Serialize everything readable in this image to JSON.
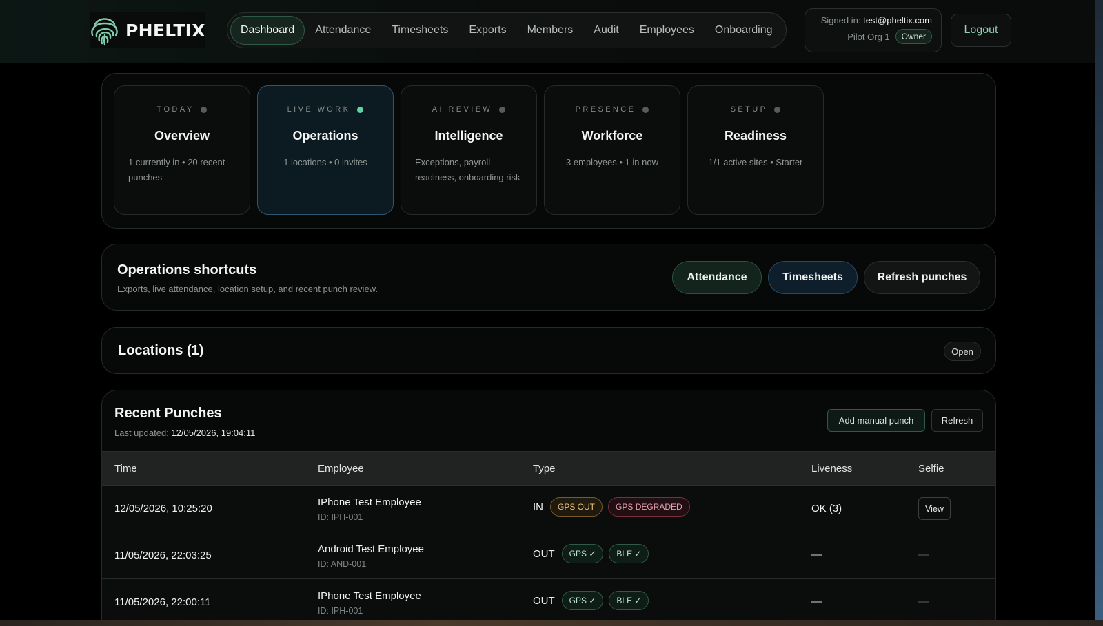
{
  "brand": {
    "name": "PHELTIX"
  },
  "nav": {
    "items": [
      {
        "label": "Dashboard",
        "active": true
      },
      {
        "label": "Attendance"
      },
      {
        "label": "Timesheets"
      },
      {
        "label": "Exports"
      },
      {
        "label": "Members"
      },
      {
        "label": "Audit"
      },
      {
        "label": "Employees"
      },
      {
        "label": "Onboarding"
      }
    ]
  },
  "account": {
    "signed_label": "Signed in:",
    "email": "test@pheltix.com",
    "org": "Pilot Org 1",
    "role": "Owner",
    "logout_label": "Logout"
  },
  "hub": {
    "cards": [
      {
        "eyebrow": "TODAY",
        "title": "Overview",
        "desc": "1 currently in • 20 recent punches"
      },
      {
        "eyebrow": "LIVE WORK",
        "title": "Operations",
        "desc": "1 locations • 0 invites",
        "active": true
      },
      {
        "eyebrow": "AI REVIEW",
        "title": "Intelligence",
        "desc": "Exceptions, payroll readiness, onboarding risk"
      },
      {
        "eyebrow": "PRESENCE",
        "title": "Workforce",
        "desc": "3 employees • 1 in now"
      },
      {
        "eyebrow": "SETUP",
        "title": "Readiness",
        "desc": "1/1 active sites • Starter"
      }
    ]
  },
  "shortcuts": {
    "title": "Operations shortcuts",
    "subtitle": "Exports, live attendance, location setup, and recent punch review.",
    "buttons": [
      "Attendance",
      "Timesheets",
      "Refresh punches"
    ]
  },
  "locations": {
    "title": "Locations (1)",
    "open_label": "Open"
  },
  "punches": {
    "title": "Recent Punches",
    "updated_label": "Last updated:",
    "updated_value": "12/05/2026, 19:04:11",
    "add_label": "Add manual punch",
    "refresh_label": "Refresh",
    "columns": [
      "Time",
      "Employee",
      "Type",
      "Liveness",
      "Selfie"
    ],
    "rows": [
      {
        "time": "12/05/2026, 10:25:20",
        "employee": "IPhone Test Employee",
        "id": "ID: IPH-001",
        "type": "IN",
        "tags": [
          "GPS OUT",
          "GPS DEGRADED"
        ],
        "liveness": "OK (3)",
        "selfie": "View"
      },
      {
        "time": "11/05/2026, 22:03:25",
        "employee": "Android Test Employee",
        "id": "ID: AND-001",
        "type": "OUT",
        "tags": [
          "GPS ✓",
          "BLE ✓"
        ],
        "liveness": "—",
        "selfie": "—"
      },
      {
        "time": "11/05/2026, 22:00:11",
        "employee": "IPhone Test Employee",
        "id": "ID: IPH-001",
        "type": "OUT",
        "tags": [
          "GPS ✓",
          "BLE ✓"
        ],
        "liveness": "—",
        "selfie": "—"
      }
    ]
  },
  "colors": {
    "accent": "#5fd3a0",
    "background": "#000000",
    "panel": "#070808"
  }
}
